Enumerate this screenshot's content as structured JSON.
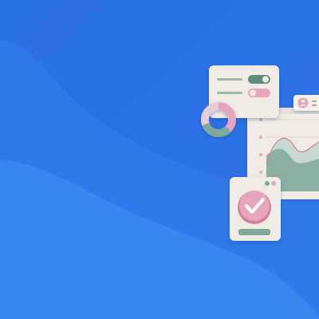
{
  "illustration": {
    "background": {
      "base": "#2d72e6",
      "wave_light": "#3a86ee",
      "wave_mid": "#3179ea"
    },
    "settings_card": {
      "toggles": [
        {
          "state": "on"
        },
        {
          "state": "off"
        }
      ]
    },
    "chart_panel": {
      "series": [
        "area-back",
        "area-front"
      ]
    },
    "check_card": {
      "icon": "check-icon"
    },
    "colors": {
      "card": "#f1ebe5",
      "card_shadow": "#d8d0c8",
      "pink": "#e7a5bd",
      "pink_dark": "#d27f9d",
      "green": "#7fa99a",
      "green_dark": "#5e8b7b",
      "area_light": "#c6d8cf",
      "grid": "#d9d3cc"
    }
  }
}
